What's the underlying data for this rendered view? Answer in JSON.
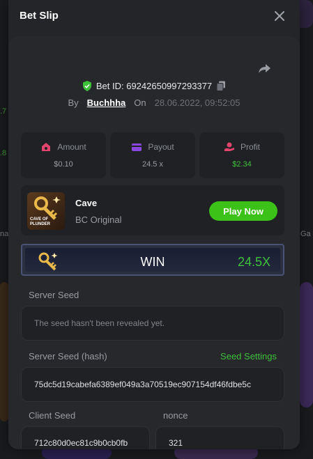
{
  "modal": {
    "title": "Bet Slip"
  },
  "bet": {
    "id_label": "Bet ID: 69242650997293377",
    "by_label": "By",
    "username": "Buchhha",
    "on_label": "On",
    "date": "28.06.2022, 09:52:05"
  },
  "stats": {
    "amount": {
      "label": "Amount",
      "value": "$0.10"
    },
    "payout": {
      "label": "Payout",
      "value": "24.5 x"
    },
    "profit": {
      "label": "Profit",
      "value": "$2.34"
    }
  },
  "game": {
    "name": "Cave",
    "provider": "BC Original",
    "thumb_text": "CAVE OF\nPLUNDER",
    "play_label": "Play Now"
  },
  "result": {
    "label": "WIN",
    "multiplier": "24.5X"
  },
  "seeds": {
    "server_seed_label": "Server Seed",
    "server_seed_value": "The seed hasn't been revealed yet.",
    "server_hash_label": "Server Seed (hash)",
    "seed_settings_label": "Seed Settings",
    "server_hash_value": "75dc5d19cabefa6389ef049a3a70519ec907154df46fdbe5c",
    "client_seed_label": "Client Seed",
    "client_seed_value": "712c80d0ec81c9b0cb0fb",
    "nonce_label": "nonce",
    "nonce_value": "321"
  },
  "colors": {
    "accent_green": "#3bc117",
    "profit_green": "#3fc03a",
    "modal_bg": "#232528",
    "card_bg": "#1f2124"
  },
  "background": {
    "edge_values": [
      ".7",
      ".8"
    ],
    "edge_labels": [
      "na",
      "Ga"
    ]
  }
}
